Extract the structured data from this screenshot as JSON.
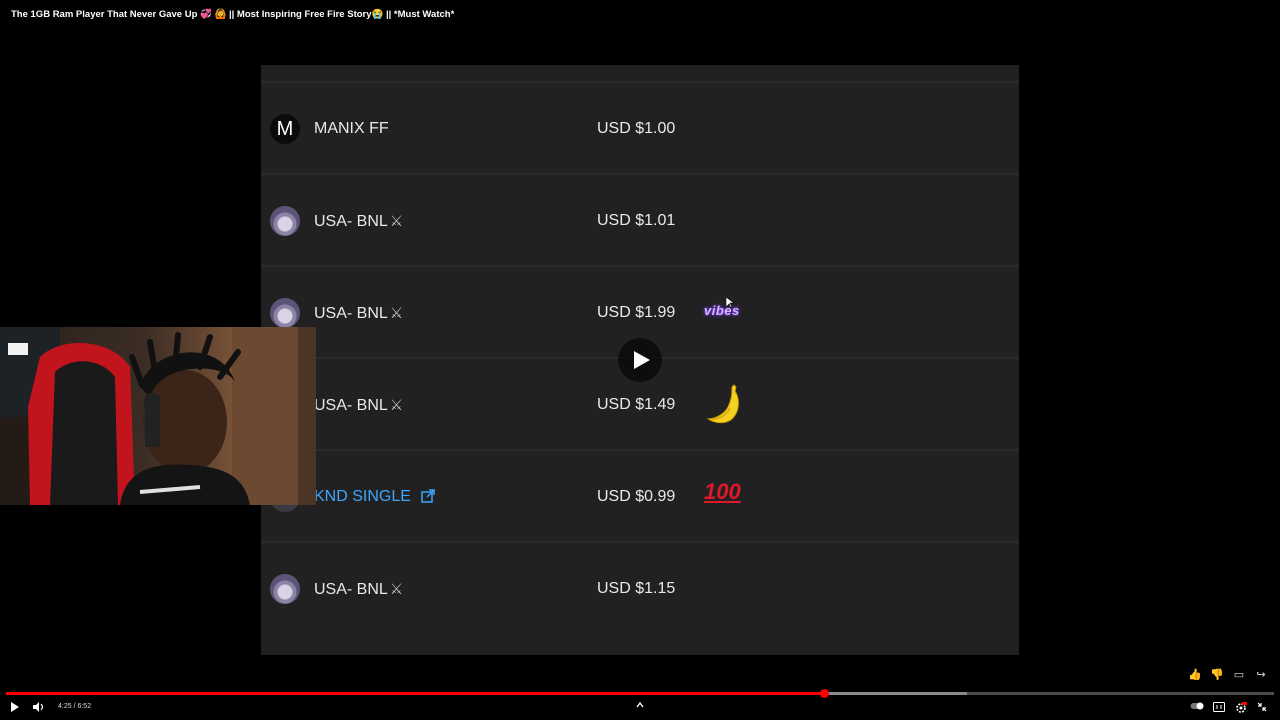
{
  "video": {
    "title": "The 1GB Ram Player That Never Gave Up 💞 🙆 || Most Inspiring Free Fire Story😭 || *Must Watch*"
  },
  "superchats": [
    {
      "avatar_letter": "M",
      "avatar_style": "m",
      "name": "MANIX FF",
      "amount": "USD $1.00",
      "sticker": ""
    },
    {
      "avatar_style": "anime",
      "name": "USA- BNL",
      "name_suffix": "⚔",
      "amount": "USD $1.01",
      "sticker": ""
    },
    {
      "avatar_style": "anime",
      "name": "USA- BNL",
      "name_suffix": "⚔",
      "amount": "USD $1.99",
      "sticker": "vibes"
    },
    {
      "avatar_style": "anime",
      "name": "USA- BNL",
      "name_suffix": "⚔",
      "amount": "USD $1.49",
      "sticker": "banana"
    },
    {
      "avatar_style": "knd",
      "name": "KND SINGLE",
      "amount": "USD $0.99",
      "sticker": "100",
      "link": true
    },
    {
      "avatar_style": "anime",
      "name": "USA- BNL",
      "name_suffix": "⚔",
      "amount": "USD $1.15",
      "sticker": ""
    }
  ],
  "player": {
    "time_display": "4:25 / 6:52",
    "progress_played": 0.645,
    "progress_buffered": 0.758,
    "colors": {
      "accent": "#ff0000",
      "link": "#3ea6ff",
      "panel": "#212121"
    }
  }
}
